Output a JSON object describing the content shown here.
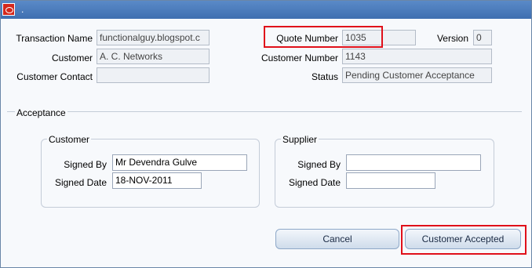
{
  "window": {
    "title": "."
  },
  "header": {
    "transaction_name": {
      "label": "Transaction Name",
      "value": "functionalguy.blogspot.c"
    },
    "customer": {
      "label": "Customer",
      "value": "A. C. Networks"
    },
    "customer_contact": {
      "label": "Customer Contact",
      "value": ""
    },
    "quote_number": {
      "label": "Quote Number",
      "value": "1035"
    },
    "version": {
      "label": "Version",
      "value": "0"
    },
    "customer_number": {
      "label": "Customer Number",
      "value": "1143"
    },
    "status": {
      "label": "Status",
      "value": "Pending Customer Acceptance"
    }
  },
  "acceptance": {
    "title": "Acceptance",
    "customer": {
      "title": "Customer",
      "signed_by_label": "Signed By",
      "signed_by_value": "Mr Devendra Gulve",
      "signed_date_label": "Signed Date",
      "signed_date_value": "18-NOV-2011"
    },
    "supplier": {
      "title": "Supplier",
      "signed_by_label": "Signed By",
      "signed_by_value": "",
      "signed_date_label": "Signed Date",
      "signed_date_value": ""
    }
  },
  "buttons": {
    "cancel": "Cancel",
    "customer_accepted": "Customer Accepted"
  },
  "colors": {
    "highlight": "#e0101a",
    "titlebar": "#4a7bbf"
  },
  "icons": {
    "app_logo": "oracle-logo-icon"
  }
}
